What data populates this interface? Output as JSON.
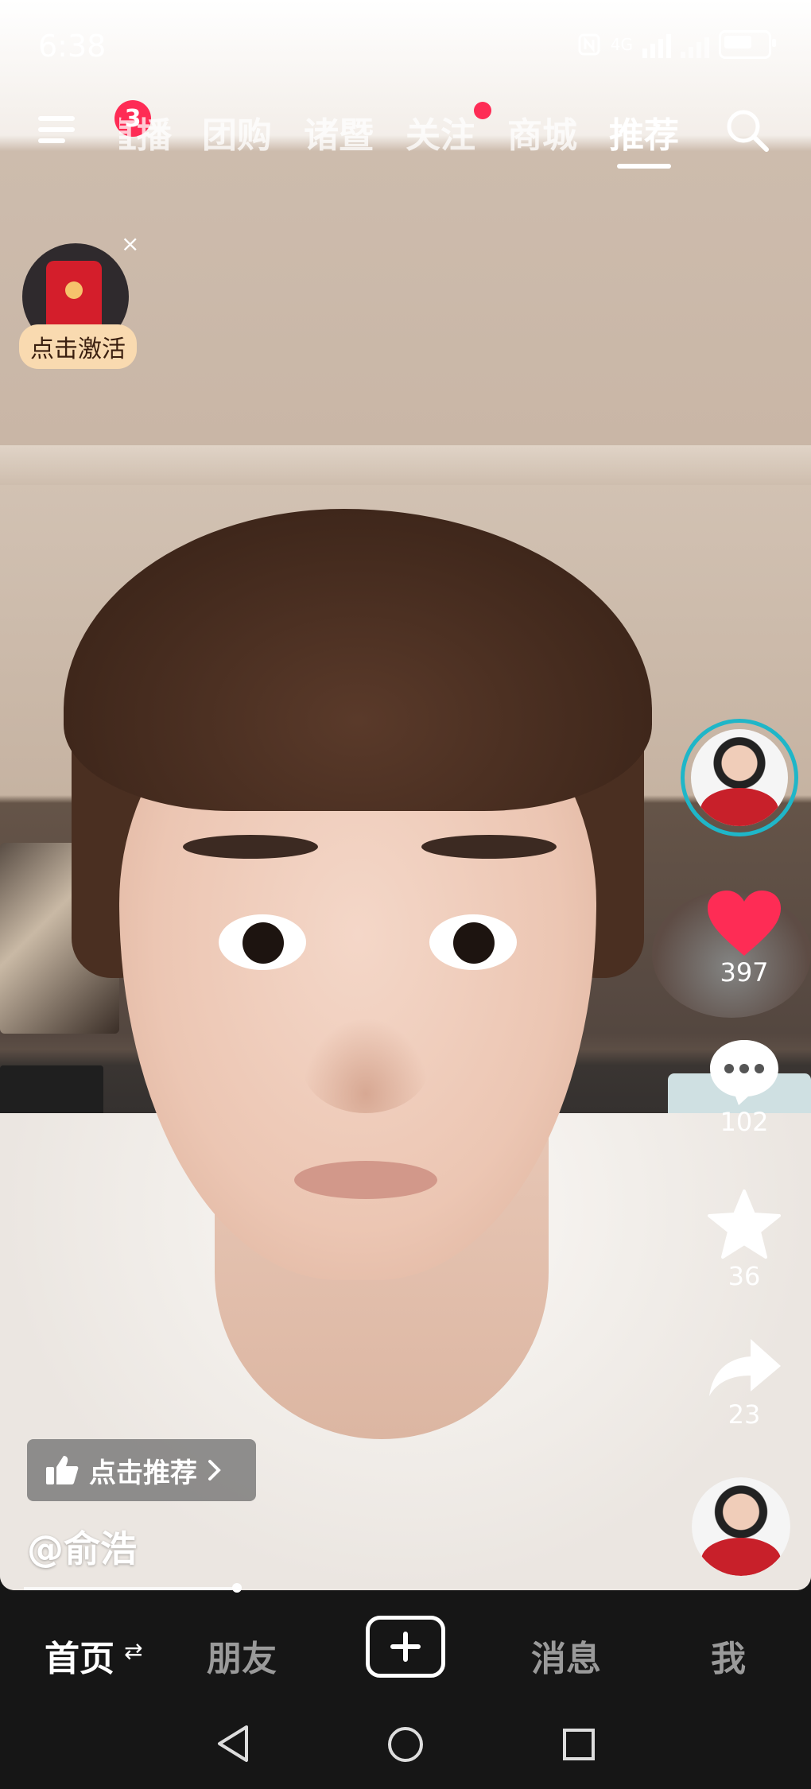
{
  "status_bar": {
    "time": "6:38",
    "network": "4G"
  },
  "top_nav": {
    "menu_badge": "3",
    "tabs": [
      {
        "label": "直播"
      },
      {
        "label": "团购"
      },
      {
        "label": "诸暨"
      },
      {
        "label": "关注"
      },
      {
        "label": "商城"
      },
      {
        "label": "推荐"
      }
    ],
    "active_tab": "推荐"
  },
  "widget": {
    "activate_label": "点击激活",
    "close": "×"
  },
  "right_rail": {
    "likes": "397",
    "comments": "102",
    "favorites": "36",
    "shares": "23"
  },
  "video_info": {
    "recommend_label": "点击推荐",
    "username": "@俞浩"
  },
  "bottom_nav": {
    "home": "首页",
    "friends": "朋友",
    "messages": "消息",
    "me": "我"
  },
  "colors": {
    "accent": "#fe2c55",
    "avatar_ring": "#1fb6c8"
  }
}
